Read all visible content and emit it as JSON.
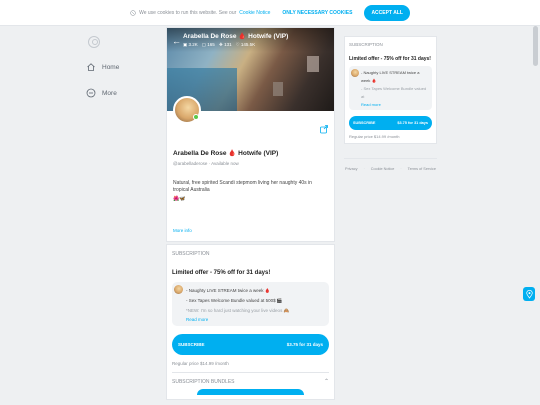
{
  "cookie": {
    "text": "We use cookies to run this website. See our",
    "link": "Cookie Notice",
    "necessary_btn": "ONLY NECESSARY COOKIES",
    "accept_btn": "ACCEPT ALL"
  },
  "nav": {
    "items": [
      {
        "label": "Home",
        "icon": "home-icon"
      },
      {
        "label": "More",
        "icon": "more-icon"
      }
    ]
  },
  "profile": {
    "banner_title": "Arabella De Rose 🩸 Hotwife (VIP)",
    "stats": [
      "3.2K",
      "165",
      "131",
      "145.5K"
    ],
    "name": "Arabella De Rose 🩸 Hotwife (VIP)",
    "handle": "@arabelladerose",
    "status": "Available now",
    "bio": "Natural, free spirited Scandi stepmom living her naughty 40s in tropical Australia",
    "bio_emoji": "🌺🦋",
    "more_info": "More info"
  },
  "subscription": {
    "label": "SUBSCRIPTION",
    "offer": "Limited offer - 75% off for 31 days!",
    "messages": [
      "- Naughty LIVE STREAM twice a week 🩸",
      "- Sex Tapes Welcome Bundle valued at 500$ 🎬",
      "*NEW: I'm so hard just watching your live videos 🙈"
    ],
    "read_more": "Read more",
    "subscribe_label": "SUBSCRIBE",
    "subscribe_price": "$3.75 for 31 days",
    "regular_price": "Regular price $14.99 /month",
    "bundles_label": "SUBSCRIPTION BUNDLES"
  },
  "sidebar": {
    "label": "SUBSCRIPTION",
    "offer": "Limited offer - 75% off for 31 days!",
    "messages": [
      "- Naughty LIVE STREAM twice a week 🩸",
      "- Sex Tapes Welcome Bundle valued at"
    ],
    "read_more": "Read more",
    "subscribe_label": "SUBSCRIBE",
    "subscribe_price": "$3.75 for 31 days",
    "regular_price": "Regular price $14.99 /month"
  },
  "footer": {
    "links": [
      "Privacy",
      "Cookie Notice",
      "Terms of Service"
    ]
  },
  "colors": {
    "accent": "#00aff0",
    "online": "#5ac84a"
  }
}
